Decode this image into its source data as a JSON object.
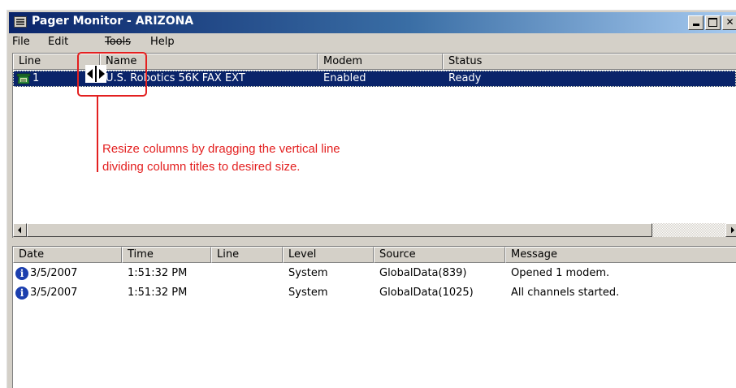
{
  "window": {
    "title": "Pager Monitor - ARIZONA",
    "controls": {
      "minimize": "_",
      "maximize": "□",
      "close": "✕"
    }
  },
  "menu": {
    "items": [
      "File",
      "Edit",
      "Tools",
      "Help"
    ]
  },
  "lines_list": {
    "headers": [
      "Line",
      "Name",
      "Modem",
      "Status"
    ],
    "rows": [
      {
        "line": "1",
        "name": "U.S. Robotics 56K FAX EXT",
        "modem": "Enabled",
        "status": "Ready",
        "icon": "phone-icon",
        "selected": true
      }
    ]
  },
  "log_list": {
    "headers": [
      "Date",
      "Time",
      "Line",
      "Level",
      "Source",
      "Message"
    ],
    "rows": [
      {
        "date": "3/5/2007",
        "time": "1:51:32 PM",
        "line": "",
        "level": "System",
        "source": "GlobalData(839)",
        "message": "Opened 1 modem.",
        "icon": "info-icon"
      },
      {
        "date": "3/5/2007",
        "time": "1:51:32 PM",
        "line": "",
        "level": "System",
        "source": "GlobalData(1025)",
        "message": "All channels started.",
        "icon": "info-icon"
      }
    ]
  },
  "annotation": {
    "line1": "Resize columns by dragging the vertical line",
    "line2": "dividing column titles to desired size.",
    "color": "#e32020"
  },
  "colors": {
    "selection": "#0a246a",
    "titlebar_start": "#0a246a",
    "titlebar_end": "#a6caf0"
  }
}
